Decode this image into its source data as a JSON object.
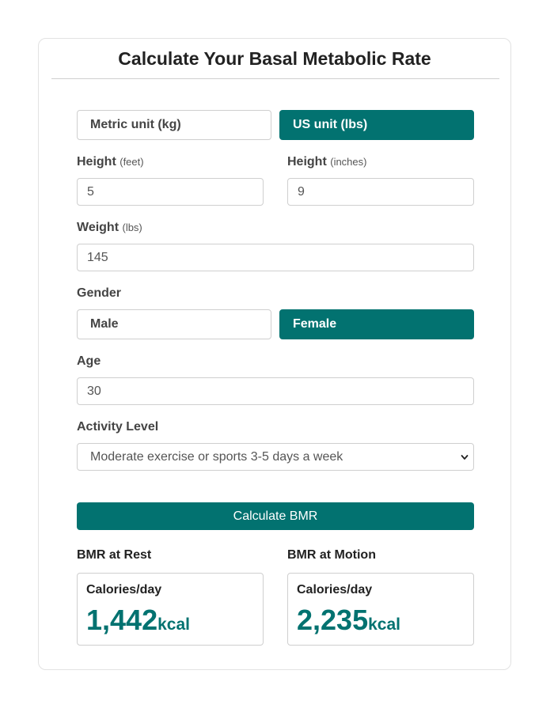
{
  "title": "Calculate Your Basal Metabolic Rate",
  "unit_toggle": {
    "metric_label": "Metric unit (kg)",
    "us_label": "US unit (lbs)",
    "selected": "us"
  },
  "height_feet": {
    "label": "Height",
    "unit": "(feet)",
    "value": "5"
  },
  "height_inches": {
    "label": "Height",
    "unit": "(inches)",
    "value": "9"
  },
  "weight": {
    "label": "Weight",
    "unit": "(lbs)",
    "value": "145"
  },
  "gender": {
    "label": "Gender",
    "male_label": "Male",
    "female_label": "Female",
    "selected": "female"
  },
  "age": {
    "label": "Age",
    "value": "30"
  },
  "activity": {
    "label": "Activity Level",
    "selected": "Moderate exercise or sports 3-5 days a week"
  },
  "calculate_label": "Calculate BMR",
  "results": {
    "rest": {
      "heading": "BMR at Rest",
      "caption": "Calories/day",
      "value": "1,442",
      "unit": "kcal"
    },
    "motion": {
      "heading": "BMR at Motion",
      "caption": "Calories/day",
      "value": "2,235",
      "unit": "kcal"
    }
  },
  "colors": {
    "accent": "#027270",
    "border": "#cfcfcf"
  },
  "icons": {
    "select_arrow": "chevron-down-icon"
  }
}
